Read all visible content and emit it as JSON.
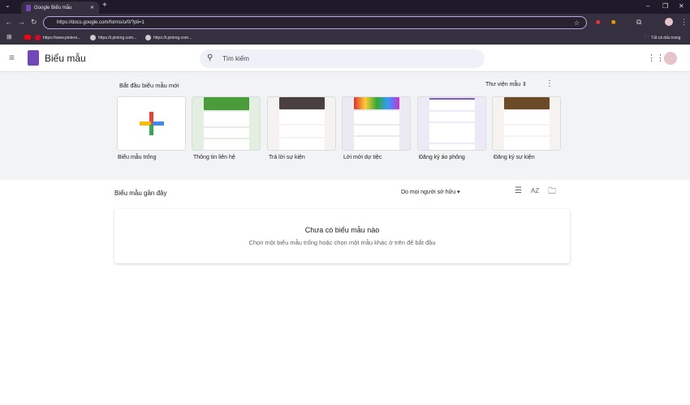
{
  "browser": {
    "tab_title": "Google Biểu mẫu",
    "url": "https://docs.google.com/forms/u/0/?pli=1",
    "bookmarks": [
      "https://www.pintere...",
      "https://i.pinimg.com...",
      "https://i.pinimg.com..."
    ],
    "all_bookmarks": "Tất cả dấu trang"
  },
  "app": {
    "title": "Biểu mẫu",
    "search_placeholder": "Tìm kiếm"
  },
  "templates": {
    "heading": "Bắt đầu biểu mẫu mới",
    "gallery": "Thư viện mẫu",
    "items": [
      {
        "label": "Biểu mẫu trống",
        "color": "#ffffff"
      },
      {
        "label": "Thông tin liên hệ",
        "color": "#e3efe0"
      },
      {
        "label": "Trả lời sự kiện",
        "color": "#f7f2f2"
      },
      {
        "label": "Lời mời dự tiệc",
        "color": "#ebeaf2"
      },
      {
        "label": "Đăng ký áo phông",
        "color": "#ede9f7"
      },
      {
        "label": "Đăng ký sự kiện",
        "color": "#f5f2f0"
      }
    ]
  },
  "recent": {
    "heading": "Biểu mẫu gần đây",
    "owner_filter": "Do mọi người sở hữu",
    "empty_title": "Chưa có biểu mẫu nào",
    "empty_sub": "Chọn một biểu mẫu trống hoặc chọn một mẫu khác ở trên để bắt đầu"
  }
}
